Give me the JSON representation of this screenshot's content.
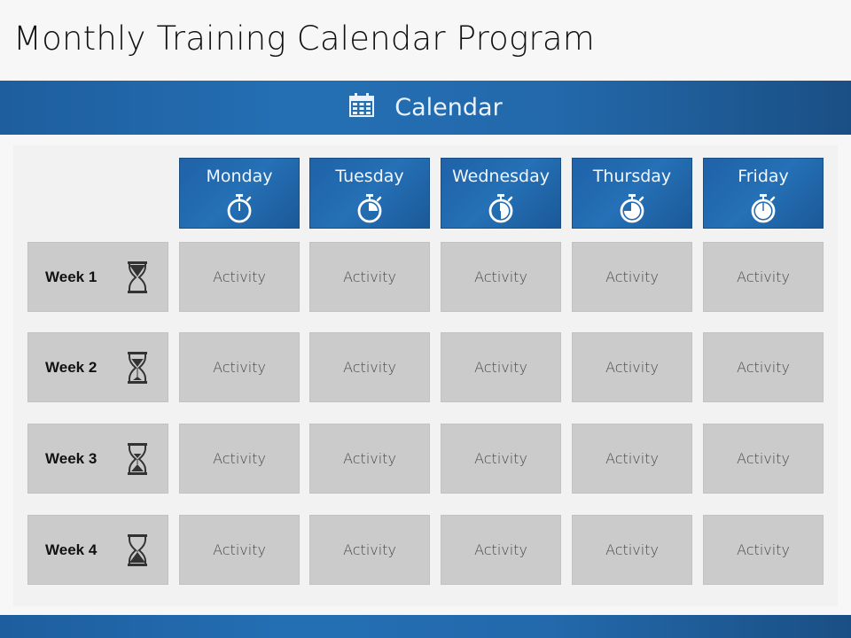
{
  "page": {
    "title": "Monthly Training Calendar Program",
    "banner": {
      "label": "Calendar",
      "icon": "calendar-icon"
    }
  },
  "colors": {
    "accent_blue": "#246fb4",
    "cell_gray": "#cbcbcb",
    "panel_gray": "#f2f2f2"
  },
  "days": [
    {
      "label": "Monday",
      "icon": "stopwatch-icon",
      "progress": 0
    },
    {
      "label": "Tuesday",
      "icon": "stopwatch-icon",
      "progress": 0.25
    },
    {
      "label": "Wednesday",
      "icon": "stopwatch-icon",
      "progress": 0.5
    },
    {
      "label": "Thursday",
      "icon": "stopwatch-icon",
      "progress": 0.75
    },
    {
      "label": "Friday",
      "icon": "stopwatch-icon",
      "progress": 1
    }
  ],
  "weeks": [
    {
      "label": "Week 1",
      "icon": "hourglass-icon",
      "sand_elapsed": 0,
      "activities": [
        "Activity",
        "Activity",
        "Activity",
        "Activity",
        "Activity"
      ]
    },
    {
      "label": "Week 2",
      "icon": "hourglass-icon",
      "sand_elapsed": 0.33,
      "activities": [
        "Activity",
        "Activity",
        "Activity",
        "Activity",
        "Activity"
      ]
    },
    {
      "label": "Week 3",
      "icon": "hourglass-icon",
      "sand_elapsed": 0.67,
      "activities": [
        "Activity",
        "Activity",
        "Activity",
        "Activity",
        "Activity"
      ]
    },
    {
      "label": "Week 4",
      "icon": "hourglass-icon",
      "sand_elapsed": 1,
      "activities": [
        "Activity",
        "Activity",
        "Activity",
        "Activity",
        "Activity"
      ]
    }
  ]
}
